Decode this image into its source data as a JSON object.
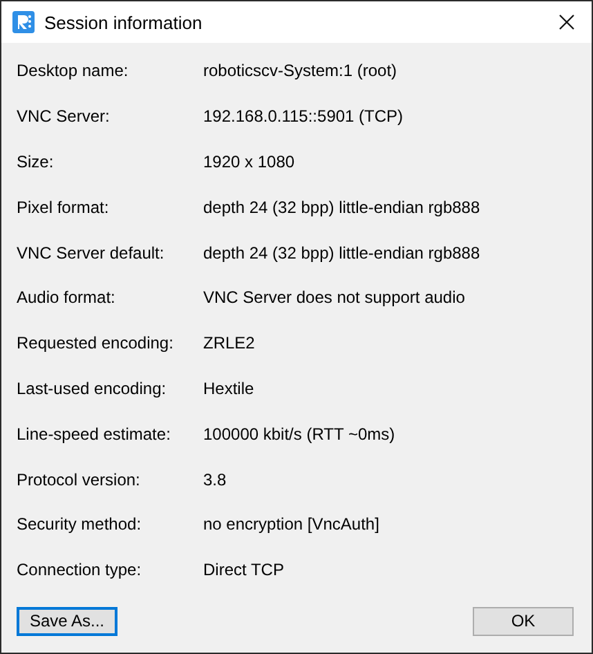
{
  "window": {
    "title": "Session information"
  },
  "fields": [
    {
      "label": "Desktop name:",
      "value": "roboticscv-System:1 (root)"
    },
    {
      "label": "VNC Server:",
      "value": "192.168.0.115::5901 (TCP)"
    },
    {
      "label": "Size:",
      "value": "1920 x 1080"
    },
    {
      "label": "Pixel format:",
      "value": "depth 24 (32 bpp) little-endian rgb888"
    },
    {
      "label": "VNC Server default:",
      "value": "depth 24 (32 bpp) little-endian rgb888"
    },
    {
      "label": "Audio format:",
      "value": "VNC Server does not support audio"
    },
    {
      "label": "Requested encoding:",
      "value": "ZRLE2"
    },
    {
      "label": "Last-used encoding:",
      "value": "Hextile"
    },
    {
      "label": "Line-speed estimate:",
      "value": "100000 kbit/s (RTT ~0ms)"
    },
    {
      "label": "Protocol version:",
      "value": "3.8"
    },
    {
      "label": "Security method:",
      "value": "no encryption [VncAuth]"
    },
    {
      "label": "Connection type:",
      "value": "Direct TCP"
    }
  ],
  "buttons": [
    {
      "label": "Save As...",
      "focused": true
    },
    {
      "label": "OK",
      "focused": false
    }
  ]
}
